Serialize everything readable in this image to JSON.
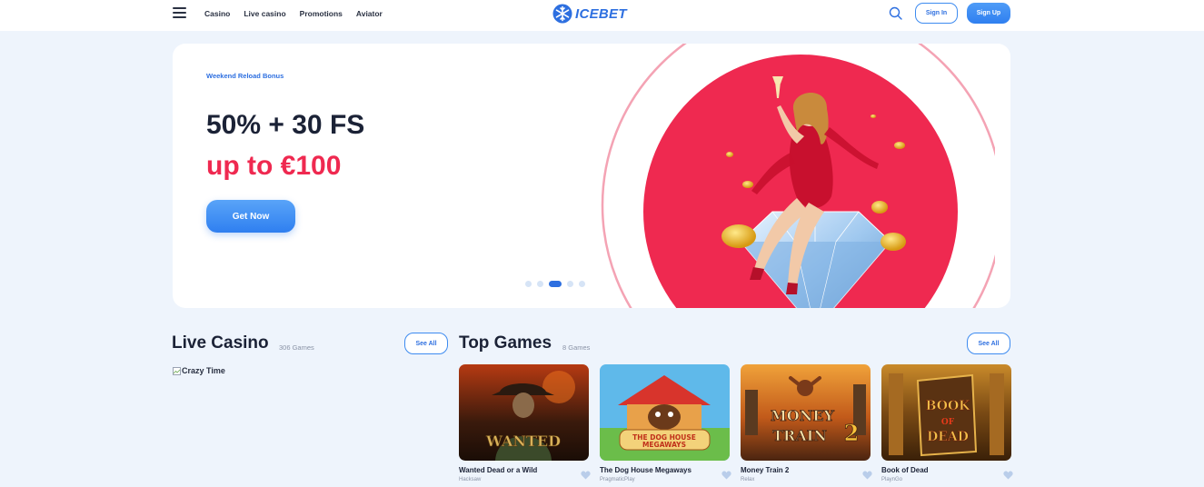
{
  "header": {
    "nav": [
      "Casino",
      "Live casino",
      "Promotions",
      "Aviator"
    ],
    "logo_text": "ICEBET",
    "sign_in": "Sign In",
    "sign_up": "Sign Up"
  },
  "banner": {
    "tag": "Weekend Reload Bonus",
    "line1": "50% + 30 FS",
    "line2": "up to €100",
    "cta": "Get Now",
    "slides_total": 5,
    "active_slide": 3
  },
  "live_casino": {
    "title": "Live Casino",
    "count": "306 Games",
    "see_all": "See All",
    "image_alt": "Crazy Time"
  },
  "top_games": {
    "title": "Top Games",
    "count": "8 Games",
    "see_all": "See All",
    "games": [
      {
        "name": "Wanted Dead or a Wild",
        "provider": "Hacksaw",
        "thumb_text": "WANTED"
      },
      {
        "name": "The Dog House Megaways",
        "provider": "PragmaticPlay",
        "thumb_text": "THE DOG HOUSE MEGAWAYS"
      },
      {
        "name": "Money Train 2",
        "provider": "Relax",
        "thumb_text": "MONEY TRAIN 2"
      },
      {
        "name": "Book of Dead",
        "provider": "PlaynGo",
        "thumb_text": "BOOK OF DEAD"
      }
    ]
  },
  "colors": {
    "accent": "#2d6fe0",
    "promo_red": "#ef2950",
    "page_bg": "#eef4fc"
  },
  "icons": [
    "hamburger-icon",
    "snowflake-icon",
    "search-icon",
    "heart-icon",
    "broken-image-icon"
  ]
}
